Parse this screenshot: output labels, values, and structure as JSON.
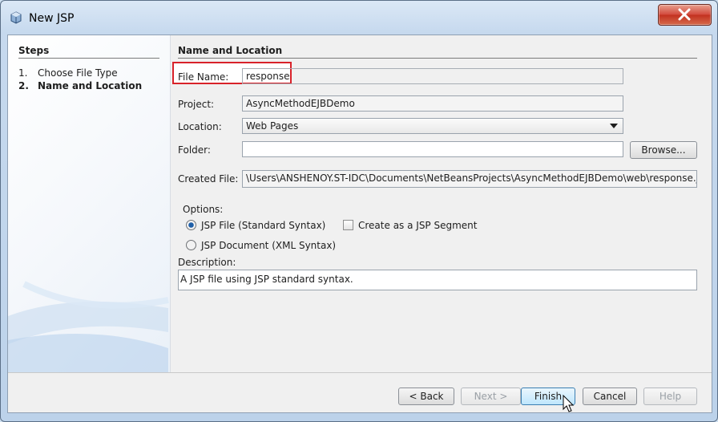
{
  "window": {
    "title": "New JSP"
  },
  "steps": {
    "heading": "Steps",
    "items": [
      {
        "num": "1.",
        "label": "Choose File Type"
      },
      {
        "num": "2.",
        "label": "Name and Location"
      }
    ]
  },
  "main": {
    "heading": "Name and Location",
    "file_name_label": "File Name:",
    "file_name_value": "response",
    "project_label": "Project:",
    "project_value": "AsyncMethodEJBDemo",
    "location_label": "Location:",
    "location_value": "Web Pages",
    "folder_label": "Folder:",
    "folder_value": "",
    "browse_label": "Browse...",
    "created_file_label": "Created File:",
    "created_file_value": "\\Users\\ANSHENOY.ST-IDC\\Documents\\NetBeansProjects\\AsyncMethodEJBDemo\\web\\response.jsp"
  },
  "options": {
    "heading": "Options:",
    "jsp_file_label": "JSP File (Standard Syntax)",
    "jsp_file_selected": true,
    "jsp_document_label": "JSP Document (XML Syntax)",
    "jsp_document_selected": false,
    "segment_label": "Create as a JSP Segment",
    "segment_checked": false,
    "description_label": "Description:",
    "description_value": "A JSP file using JSP standard syntax."
  },
  "buttons": {
    "back": "< Back",
    "next": "Next >",
    "finish": "Finish",
    "cancel": "Cancel",
    "help": "Help"
  },
  "colors": {
    "highlight": "#d8222a",
    "radio_selected": "#1f5fa8"
  }
}
